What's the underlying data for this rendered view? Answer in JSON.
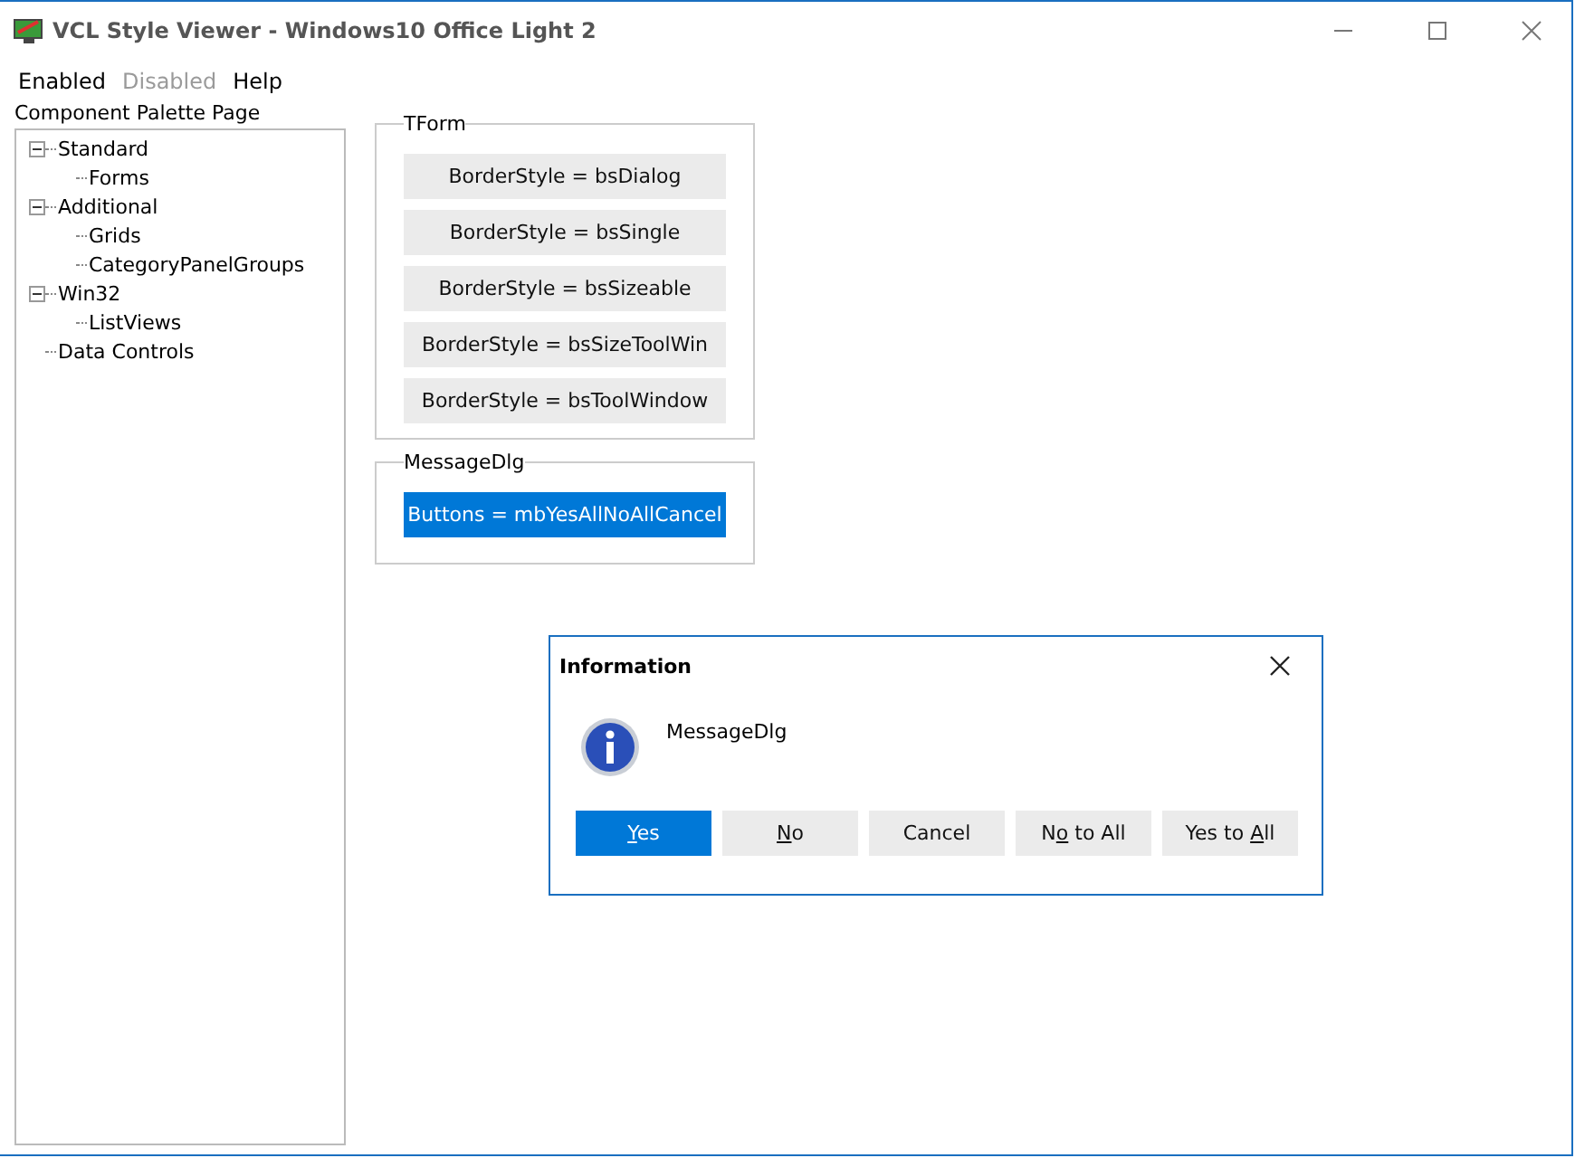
{
  "window": {
    "title": "VCL Style Viewer - Windows10 Office Light 2"
  },
  "menu": [
    {
      "label": "Enabled",
      "disabled": false
    },
    {
      "label": "Disabled",
      "disabled": true
    },
    {
      "label": "Help",
      "disabled": false
    }
  ],
  "palette_label": "Component Palette Page",
  "tree": [
    {
      "label": "Standard",
      "expanded": true,
      "children": [
        {
          "label": "Forms"
        }
      ]
    },
    {
      "label": "Additional",
      "expanded": true,
      "children": [
        {
          "label": "Grids"
        },
        {
          "label": "CategoryPanelGroups"
        }
      ]
    },
    {
      "label": "Win32",
      "expanded": true,
      "children": [
        {
          "label": "ListViews"
        }
      ]
    },
    {
      "label": "Data Controls"
    }
  ],
  "groups": [
    {
      "title": "TForm",
      "buttons": [
        {
          "label": "BorderStyle = bsDialog",
          "selected": false
        },
        {
          "label": "BorderStyle = bsSingle",
          "selected": false
        },
        {
          "label": "BorderStyle = bsSizeable",
          "selected": false
        },
        {
          "label": "BorderStyle = bsSizeToolWin",
          "selected": false
        },
        {
          "label": "BorderStyle = bsToolWindow",
          "selected": false
        }
      ]
    },
    {
      "title": "MessageDlg",
      "buttons": [
        {
          "label": "Buttons = mbYesAllNoAllCancel",
          "selected": true
        }
      ]
    }
  ],
  "dialog": {
    "title": "Information",
    "message": "MessageDlg",
    "buttons": [
      {
        "key": "Y",
        "after": "es",
        "selected": true
      },
      {
        "key": "N",
        "after": "o",
        "selected": false
      },
      {
        "before": "Cancel",
        "selected": false
      },
      {
        "before": "N",
        "key": "o",
        "after": " to All",
        "selected": false
      },
      {
        "before": "Yes to ",
        "key": "A",
        "after": "ll",
        "selected": false
      }
    ]
  }
}
